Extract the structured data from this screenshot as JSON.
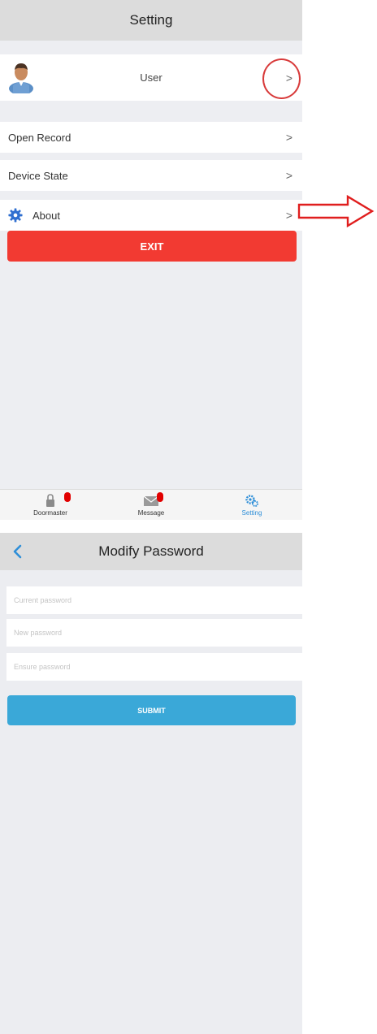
{
  "settings_screen": {
    "title": "Setting",
    "user_label": "User",
    "chevron": ">",
    "menu": [
      {
        "label": "Open Record"
      },
      {
        "label": "Device State"
      },
      {
        "label": "About"
      }
    ],
    "exit_label": "EXIT",
    "tabs": [
      {
        "label": "Doormaster",
        "icon": "lock-icon"
      },
      {
        "label": "Message",
        "icon": "mail-icon"
      },
      {
        "label": "Setting",
        "icon": "gears-icon"
      }
    ]
  },
  "password_screen": {
    "title": "Modify Password",
    "fields": [
      {
        "placeholder": "Current password",
        "value": ""
      },
      {
        "placeholder": "New password",
        "value": ""
      },
      {
        "placeholder": "Ensure password",
        "value": ""
      }
    ],
    "submit_label": "SUBMIT"
  },
  "colors": {
    "exit_button": "#f23a32",
    "submit_button": "#3aa8d8",
    "badge": "#e10000",
    "annotation": "#d83a3a",
    "active_tab": "#2f8fd8"
  }
}
